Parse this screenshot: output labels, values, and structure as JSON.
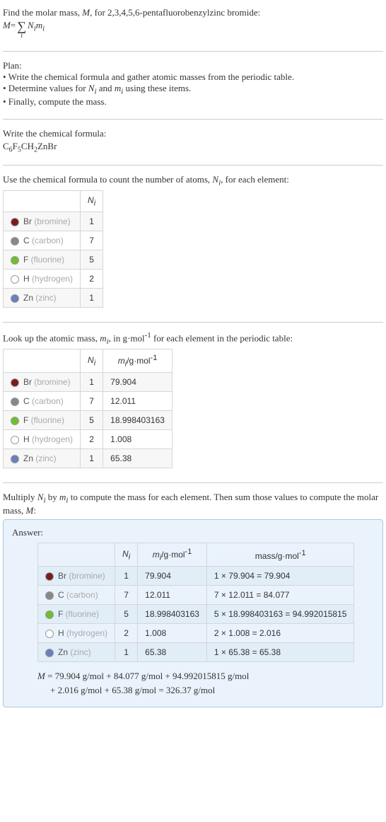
{
  "intro": {
    "line1_prefix": "Find the molar mass, ",
    "line1_M": "M",
    "line1_mid": ", for 2,3,4,5,6-pentafluorobenzylzinc bromide:",
    "eq_M": "M",
    "eq_eq": " = ",
    "eq_Ni": "N",
    "eq_mi": "m",
    "eq_i": "i"
  },
  "plan": {
    "heading": "Plan:",
    "b1": "• Write the chemical formula and gather atomic masses from the periodic table.",
    "b2_pre": "• Determine values for ",
    "b2_n": "N",
    "b2_and": " and ",
    "b2_m": "m",
    "b2_i": "i",
    "b2_post": " using these items.",
    "b3": "• Finally, compute the mass."
  },
  "chem": {
    "heading": "Write the chemical formula:",
    "formula_parts": [
      "C",
      "6",
      "F",
      "5",
      "CH",
      "2",
      "ZnBr"
    ]
  },
  "count": {
    "heading_pre": "Use the chemical formula to count the number of atoms, ",
    "heading_N": "N",
    "heading_i": "i",
    "heading_post": ", for each element:",
    "col_N": "N",
    "col_i": "i",
    "rows": [
      {
        "swatch": "#7a1b1b",
        "name": "Br",
        "suffix": " (bromine)",
        "n": "1"
      },
      {
        "swatch": "#888888",
        "name": "C",
        "suffix": " (carbon)",
        "n": "7"
      },
      {
        "swatch": "#6fbf2a",
        "name": "F",
        "suffix": " (fluorine)",
        "n": "5"
      },
      {
        "swatch": "#ffffff",
        "name": "H",
        "suffix": " (hydrogen)",
        "n": "2"
      },
      {
        "swatch": "#6a7fbf",
        "name": "Zn",
        "suffix": " (zinc)",
        "n": "1"
      }
    ]
  },
  "lookup": {
    "heading_pre": "Look up the atomic mass, ",
    "heading_m": "m",
    "heading_i": "i",
    "heading_mid": ", in g·mol",
    "heading_exp": "-1",
    "heading_post": " for each element in the periodic table:",
    "col_N": "N",
    "col_m": "m",
    "col_i": "i",
    "col_unit_pre": "/g·mol",
    "col_unit_exp": "-1",
    "rows": [
      {
        "swatch": "#7a1b1b",
        "name": "Br",
        "suffix": " (bromine)",
        "n": "1",
        "m": "79.904"
      },
      {
        "swatch": "#888888",
        "name": "C",
        "suffix": " (carbon)",
        "n": "7",
        "m": "12.011"
      },
      {
        "swatch": "#6fbf2a",
        "name": "F",
        "suffix": " (fluorine)",
        "n": "5",
        "m": "18.998403163"
      },
      {
        "swatch": "#ffffff",
        "name": "H",
        "suffix": " (hydrogen)",
        "n": "2",
        "m": "1.008"
      },
      {
        "swatch": "#6a7fbf",
        "name": "Zn",
        "suffix": " (zinc)",
        "n": "1",
        "m": "65.38"
      }
    ]
  },
  "multiply": {
    "heading_pre": "Multiply ",
    "heading_N": "N",
    "heading_by": " by ",
    "heading_m": "m",
    "heading_i": "i",
    "heading_mid": " to compute the mass for each element. Then sum those values to compute the molar mass, ",
    "heading_M": "M",
    "heading_post": ":"
  },
  "answer": {
    "title": "Answer:",
    "col_N": "N",
    "col_m": "m",
    "col_i": "i",
    "col_unit_pre": "/g·mol",
    "col_unit_exp": "-1",
    "col_mass_pre": "mass/g·mol",
    "col_mass_exp": "-1",
    "rows": [
      {
        "swatch": "#7a1b1b",
        "name": "Br",
        "suffix": " (bromine)",
        "n": "1",
        "m": "79.904",
        "mass": "1 × 79.904 = 79.904"
      },
      {
        "swatch": "#888888",
        "name": "C",
        "suffix": " (carbon)",
        "n": "7",
        "m": "12.011",
        "mass": "7 × 12.011 = 84.077"
      },
      {
        "swatch": "#6fbf2a",
        "name": "F",
        "suffix": " (fluorine)",
        "n": "5",
        "m": "18.998403163",
        "mass": "5 × 18.998403163 = 94.992015815"
      },
      {
        "swatch": "#ffffff",
        "name": "H",
        "suffix": " (hydrogen)",
        "n": "2",
        "m": "1.008",
        "mass": "2 × 1.008 = 2.016"
      },
      {
        "swatch": "#6a7fbf",
        "name": "Zn",
        "suffix": " (zinc)",
        "n": "1",
        "m": "65.38",
        "mass": "1 × 65.38 = 65.38"
      }
    ],
    "final_M": "M",
    "final_line1": " = 79.904 g/mol + 84.077 g/mol + 94.992015815 g/mol",
    "final_line2": "+ 2.016 g/mol + 65.38 g/mol = 326.37 g/mol"
  },
  "chart_data": {
    "type": "table",
    "title": "Molar mass computation for 2,3,4,5,6-pentafluorobenzylzinc bromide",
    "elements": [
      {
        "symbol": "Br",
        "name": "bromine",
        "count": 1,
        "atomic_mass_g_per_mol": 79.904,
        "mass_contribution_g_per_mol": 79.904
      },
      {
        "symbol": "C",
        "name": "carbon",
        "count": 7,
        "atomic_mass_g_per_mol": 12.011,
        "mass_contribution_g_per_mol": 84.077
      },
      {
        "symbol": "F",
        "name": "fluorine",
        "count": 5,
        "atomic_mass_g_per_mol": 18.998403163,
        "mass_contribution_g_per_mol": 94.992015815
      },
      {
        "symbol": "H",
        "name": "hydrogen",
        "count": 2,
        "atomic_mass_g_per_mol": 1.008,
        "mass_contribution_g_per_mol": 2.016
      },
      {
        "symbol": "Zn",
        "name": "zinc",
        "count": 1,
        "atomic_mass_g_per_mol": 65.38,
        "mass_contribution_g_per_mol": 65.38
      }
    ],
    "molar_mass_g_per_mol": 326.37
  }
}
